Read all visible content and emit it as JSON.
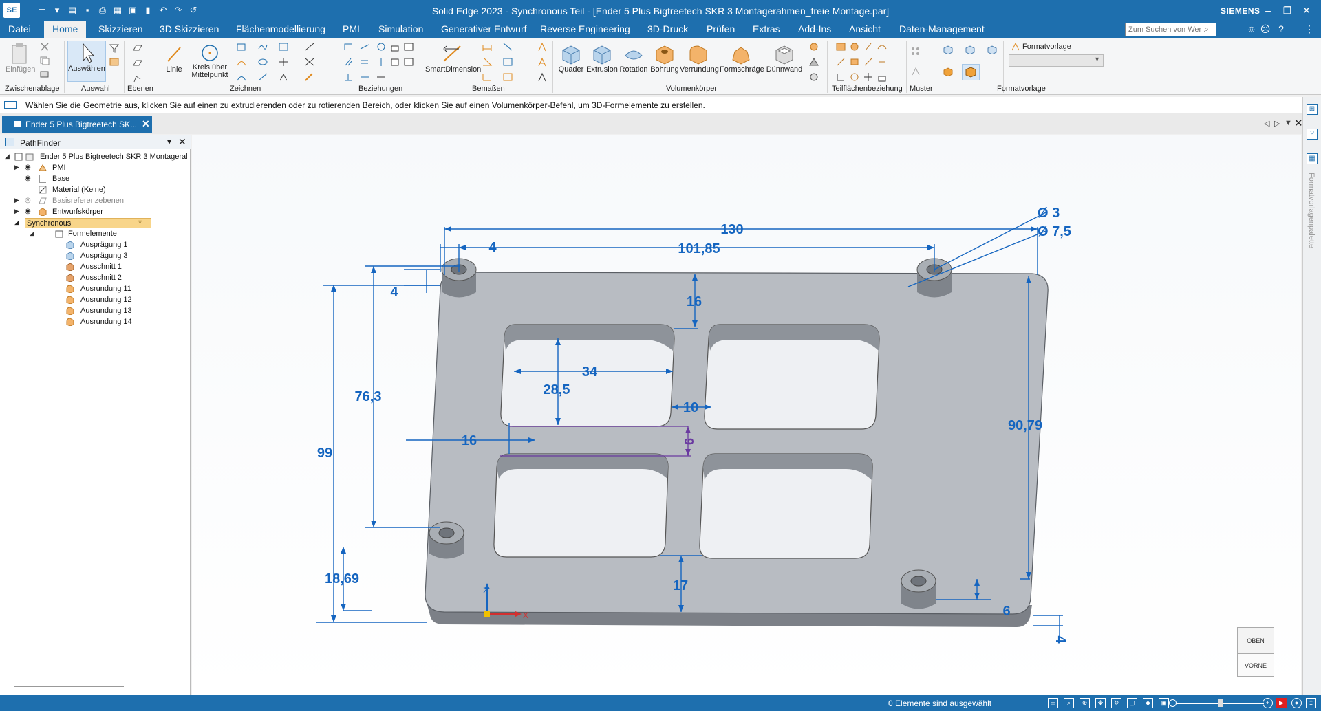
{
  "app": {
    "icon_label": "SE",
    "title": "Solid Edge 2023 - Synchronous Teil - [Ender 5 Plus Bigtreetech SKR 3 Montagerahmen_freie Montage.par]",
    "brand": "SIEMENS"
  },
  "quick_access": [
    "new-file-icon",
    "open-icon",
    "save-icon",
    "print-icon",
    "undo-icon",
    "redo-icon"
  ],
  "menu": {
    "tabs": [
      "Datei",
      "Home",
      "Skizzieren",
      "3D Skizzieren",
      "Flächenmodellierung",
      "PMI",
      "Simulation",
      "Generativer Entwurf",
      "Reverse Engineering",
      "3D-Druck",
      "Prüfen",
      "Extras",
      "Add-Ins",
      "Ansicht",
      "Daten-Management"
    ],
    "active_tab": "Home",
    "search_placeholder": "Zum Suchen von Wer"
  },
  "ribbon": {
    "buttons": {
      "einfuegen": "Einfügen",
      "auswaehlen": "Auswählen",
      "linie": "Linie",
      "kreis_line1": "Kreis über",
      "kreis_line2": "Mittelpunkt",
      "smartdimension": "SmartDimension",
      "quader": "Quader",
      "extrusion": "Extrusion",
      "rotation": "Rotation",
      "bohrung": "Bohrung",
      "verrundung": "Verrundung",
      "formschraege": "Formschräge",
      "duennwand": "Dünnwand",
      "formatvorlage": "Formatvorlage"
    },
    "groups": {
      "zwischenablage": "Zwischenablage",
      "auswahl": "Auswahl",
      "ebenen": "Ebenen",
      "zeichnen": "Zeichnen",
      "beziehungen": "Beziehungen",
      "bemassen": "Bemaßen",
      "volumenkoerper": "Volumenkörper",
      "teilflaechenbeziehung": "Teilflächenbeziehung",
      "muster": "Muster",
      "formatvorlage": "Formatvorlage"
    }
  },
  "prompt": "Wählen Sie die Geometrie aus, klicken Sie auf einen zu extrudierenden oder zu rotierenden Bereich, oder klicken Sie auf einen Volumenkörper-Befehl, um 3D-Formelemente zu erstellen.",
  "document_tab": "Ender 5 Plus Bigtreetech SK...",
  "pathfinder": {
    "title": "PathFinder",
    "root": "Ender 5 Plus Bigtreetech SKR 3 Montageral",
    "nodes": {
      "pmi": "PMI",
      "base": "Base",
      "material": "Material (Keine)",
      "basisreferenzebenen": "Basisreferenzebenen",
      "entwurfskoerper": "Entwurfskörper",
      "synchronous": "Synchronous",
      "formelemente": "Formelemente"
    },
    "features": [
      "Ausprägung 1",
      "Ausprägung 3",
      "Ausschnitt 1",
      "Ausschnitt 2",
      "Ausrundung 11",
      "Ausrundung 12",
      "Ausrundung 13",
      "Ausrundung 14"
    ]
  },
  "right_panel_label": "Formatvorlagenpalette",
  "dimensions": {
    "d130": "130",
    "d101_85": "101,85",
    "d4_top": "4",
    "d4_left": "4",
    "dia3": "Ø 3",
    "dia7_5": "Ø 7,5",
    "d16_top": "16",
    "d34": "34",
    "d28_5": "28,5",
    "d10": "10",
    "d16_left": "16",
    "d9": "9",
    "d76_3": "76,3",
    "d99": "99",
    "d18_69": "18,69",
    "d17": "17",
    "d90_79": "90,79",
    "d6": "6",
    "d4_bottom": "4"
  },
  "axes": {
    "z": "Z",
    "x": "X"
  },
  "view_cube": {
    "top": "OBEN",
    "front": "VORNE"
  },
  "status": {
    "text": "0 Elemente sind ausgewählt"
  },
  "colors": {
    "accent": "#1e6fae",
    "dimension": "#1565c0",
    "part": "#b9bdc3",
    "selection": "#6a3aa0"
  }
}
